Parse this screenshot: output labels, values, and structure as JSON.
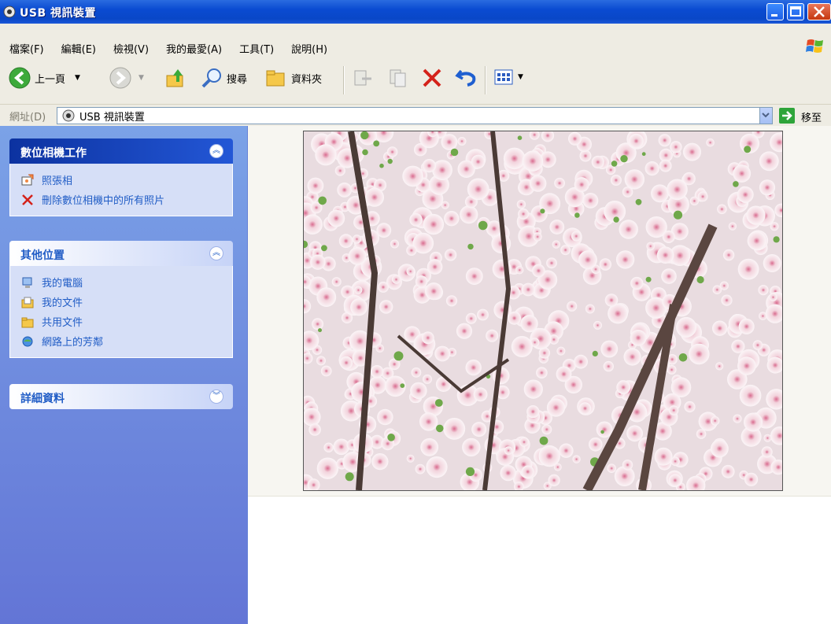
{
  "window": {
    "title": "USB 視訊裝置"
  },
  "menu": {
    "items": [
      "檔案(F)",
      "編輯(E)",
      "檢視(V)",
      "我的最愛(A)",
      "工具(T)",
      "說明(H)"
    ]
  },
  "toolbar": {
    "back_label": "上一頁",
    "search_label": "搜尋",
    "folders_label": "資料夾"
  },
  "address": {
    "label": "網址(D)",
    "value": "USB 視訊裝置",
    "go_label": "移至"
  },
  "tasks": {
    "camera_panel": {
      "title": "數位相機工作",
      "items": [
        "照張相",
        "刪除數位相機中的所有照片"
      ]
    },
    "other_panel": {
      "title": "其他位置",
      "items": [
        "我的電腦",
        "我的文件",
        "共用文件",
        "網路上的芳鄰"
      ]
    },
    "details_panel": {
      "title": "詳細資料"
    }
  },
  "colors": {
    "title_bar": "#0A4BD1",
    "task_pane": "#7BA2E7",
    "link": "#215DC6"
  }
}
